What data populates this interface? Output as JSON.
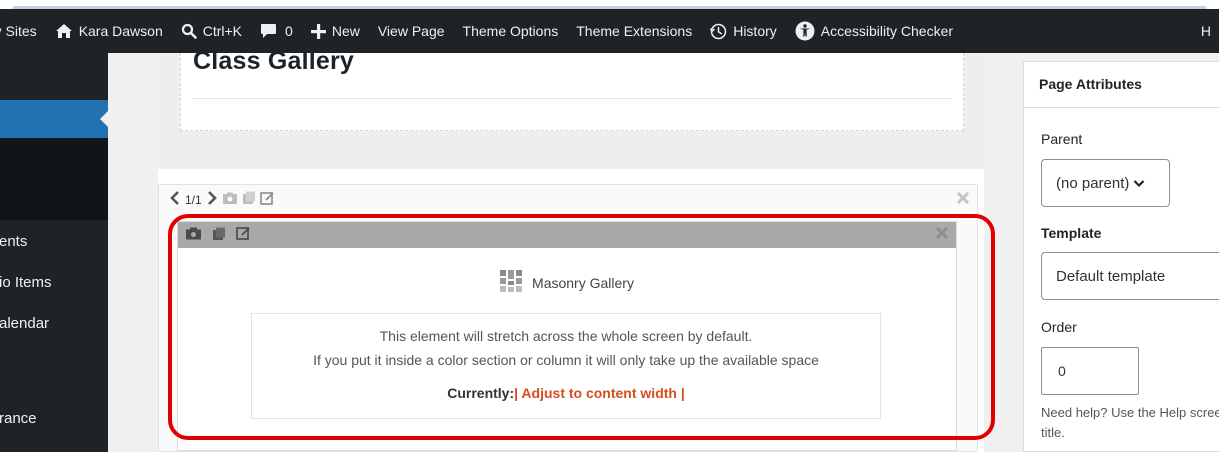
{
  "adminbar": {
    "my_sites": "My Sites",
    "user_site": "Kara Dawson",
    "search_shortcut": "Ctrl+K",
    "comments_count": "0",
    "new_label": "New",
    "view_page": "View Page",
    "theme_options": "Theme Options",
    "theme_extensions": "Theme Extensions",
    "history": "History",
    "accessibility": "Accessibility Checker",
    "howdy": "H"
  },
  "adminmenu": {
    "items": [
      "ents",
      "io Items",
      "alendar",
      "rance"
    ]
  },
  "editor": {
    "page_title": "Class Gallery",
    "pager": "1/1",
    "element": {
      "name": "Masonry Gallery",
      "info_line1": "This element will stretch across the whole screen by default.",
      "info_line2": "If you put it inside a color section or column it will only take up the available space",
      "currently_label": "Currently:",
      "currently_value": "| Adjust to content width |"
    }
  },
  "sidebar": {
    "title": "Page Attributes",
    "parent_label": "Parent",
    "parent_value": "(no parent)",
    "template_label": "Template",
    "template_value": "Default template",
    "order_label": "Order",
    "order_value": "0",
    "help_text": "Need help? Use the Help screen title."
  },
  "colors": {
    "adminbar_bg": "#1d2327",
    "menu_current": "#2271b1",
    "highlight": "#e00000",
    "accent": "#d64e1f"
  }
}
